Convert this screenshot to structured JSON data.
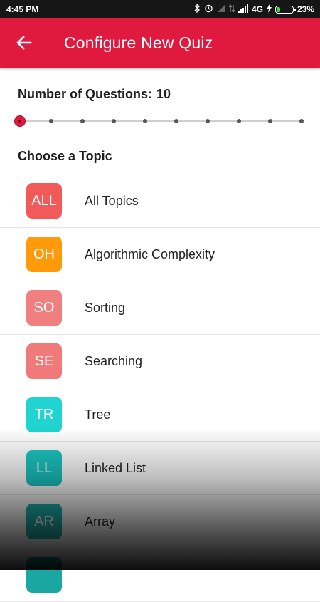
{
  "status_bar": {
    "time": "4:45 PM",
    "network": "4G",
    "battery_text": "23%",
    "battery_level_percent": 23,
    "icons": [
      "bluetooth-icon",
      "alarm-icon",
      "signal-icon",
      "data-arrows-icon",
      "signal-strength-icon",
      "charging-icon",
      "battery-icon"
    ]
  },
  "appbar": {
    "title": "Configure New Quiz",
    "back_icon": "arrow-left-icon",
    "color": "#e0193f"
  },
  "questions": {
    "label": "Number of Questions:",
    "value": "10",
    "slider": {
      "selected_index": 0,
      "tick_count": 10
    }
  },
  "topics_heading": "Choose a Topic",
  "topics": [
    {
      "abbr": "ALL",
      "label": "All Topics",
      "color": "#f25a5a"
    },
    {
      "abbr": "OH",
      "label": "Algorithmic Complexity",
      "color": "#ff9a0a"
    },
    {
      "abbr": "SO",
      "label": "Sorting",
      "color": "#f08080"
    },
    {
      "abbr": "SE",
      "label": "Searching",
      "color": "#f07a7a"
    },
    {
      "abbr": "TR",
      "label": "Tree",
      "color": "#20d5cf"
    },
    {
      "abbr": "LL",
      "label": "Linked List",
      "color": "#1bc6c2"
    },
    {
      "abbr": "AR",
      "label": "Array",
      "color": "#1fb3ae"
    },
    {
      "abbr": "",
      "label": "",
      "color": "#1aa6a1"
    }
  ]
}
